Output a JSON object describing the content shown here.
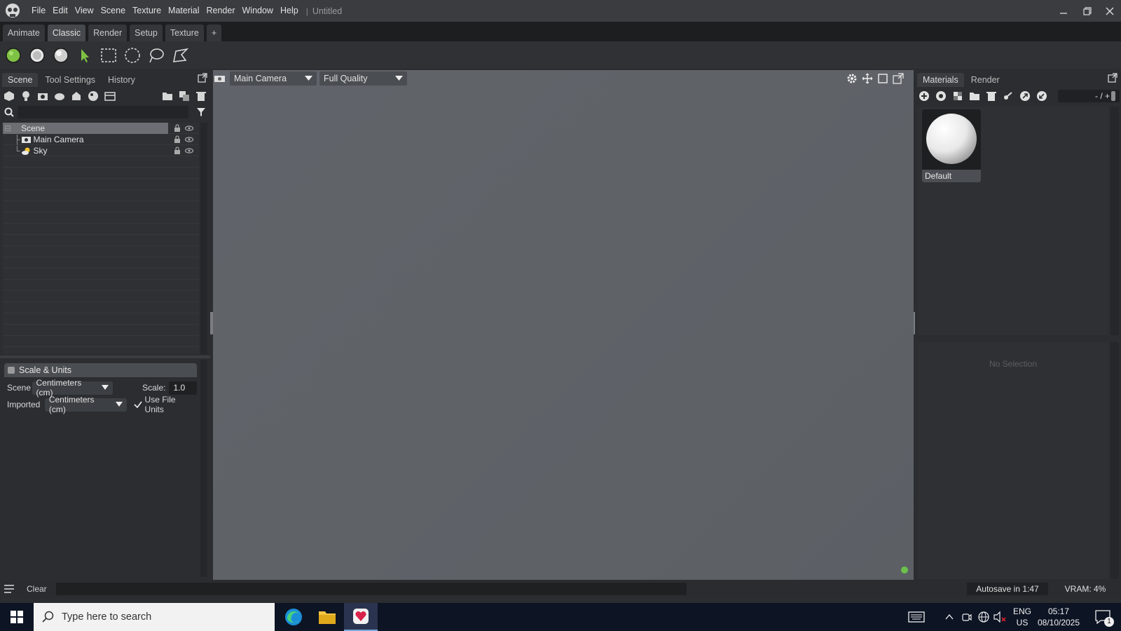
{
  "app": {
    "menu": [
      "File",
      "Edit",
      "View",
      "Scene",
      "Texture",
      "Material",
      "Render",
      "Window",
      "Help"
    ],
    "document_title": "Untitled"
  },
  "workspace_tabs": [
    {
      "label": "Animate",
      "active": false
    },
    {
      "label": "Classic",
      "active": true
    },
    {
      "label": "Render",
      "active": false
    },
    {
      "label": "Setup",
      "active": false
    },
    {
      "label": "Texture",
      "active": false
    },
    {
      "label": "+",
      "active": false
    }
  ],
  "toolbar": {
    "icons": [
      "material-render-mode-icon",
      "solid-render-mode-icon",
      "shaded-render-mode-icon",
      "select-arrow-icon",
      "rect-select-icon",
      "circle-select-icon",
      "lasso-select-icon",
      "polygon-select-icon"
    ],
    "accent": "#7ec144"
  },
  "left_panel": {
    "tabs": [
      "Scene",
      "Tool Settings",
      "History"
    ],
    "active_tab": "Scene",
    "search": {
      "value": "",
      "placeholder": ""
    },
    "tree": [
      {
        "label": "Scene",
        "icon": "scene-icon",
        "selected": true,
        "indent": 0
      },
      {
        "label": "Main Camera",
        "icon": "camera-icon",
        "selected": false,
        "indent": 1
      },
      {
        "label": "Sky",
        "icon": "sky-icon",
        "selected": false,
        "indent": 1
      }
    ],
    "scale_units": {
      "title": "Scale & Units",
      "scene_label": "Scene",
      "scene_unit": "Centimeters (cm)",
      "scale_label": "Scale:",
      "scale_value": "1.0",
      "imported_label": "Imported",
      "imported_unit": "Centimeters (cm)",
      "use_file_units_label": "Use File Units",
      "use_file_units_checked": true
    }
  },
  "viewport": {
    "camera": "Main Camera",
    "quality": "Full Quality",
    "status_color": "#6cc04a"
  },
  "right_panel": {
    "tabs": [
      "Materials",
      "Render"
    ],
    "active_tab": "Materials",
    "zoom_label": "- / +",
    "materials": [
      {
        "name": "Default"
      }
    ],
    "properties_empty": "No Selection"
  },
  "statusbar": {
    "clear_label": "Clear",
    "autosave": "Autosave in 1:47",
    "vram": "VRAM: 4%"
  },
  "taskbar": {
    "search_placeholder": "Type here to search",
    "lang_top": "ENG",
    "lang_bottom": "US",
    "time": "05:17",
    "date": "08/10/2025",
    "notifications": "1"
  }
}
